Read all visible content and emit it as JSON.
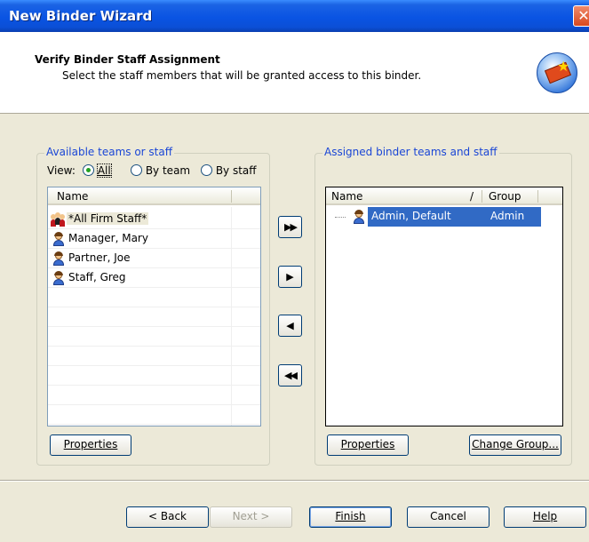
{
  "window": {
    "title": "New Binder Wizard",
    "close_glyph": "✕"
  },
  "header": {
    "title": "Verify Binder Staff Assignment",
    "subtitle": "Select the staff members that will be granted access to this binder.",
    "icon": "binder-book-icon"
  },
  "available": {
    "group_label": "Available teams or staff",
    "view_label": "View:",
    "view_options": [
      {
        "label": "All",
        "checked": true
      },
      {
        "label": "By team",
        "checked": false
      },
      {
        "label": "By staff",
        "checked": false
      }
    ],
    "column_name": "Name",
    "items": [
      {
        "label": "*All Firm Staff*",
        "icon": "group-icon"
      },
      {
        "label": "Manager, Mary",
        "icon": "person-icon"
      },
      {
        "label": "Partner, Joe",
        "icon": "person-icon"
      },
      {
        "label": "Staff, Greg",
        "icon": "person-icon"
      }
    ],
    "properties_label": "Properties"
  },
  "movers": {
    "add_all": "▶▶",
    "add": "▶",
    "remove": "◀",
    "remove_all": "◀◀"
  },
  "assigned": {
    "group_label": "Assigned binder teams and staff",
    "column_name": "Name",
    "sort_glyph": "/",
    "column_group": "Group",
    "items": [
      {
        "name": "Admin, Default",
        "group": "Admin"
      }
    ],
    "properties_label": "Properties",
    "change_group_label": "Change Group..."
  },
  "footer": {
    "back": "< Back",
    "next": "Next >",
    "finish": "Finish",
    "cancel": "Cancel",
    "help": "Help"
  },
  "colors": {
    "title_bar": "#0a54e3",
    "selection": "#316ac5",
    "group_label": "#1a46d6"
  }
}
